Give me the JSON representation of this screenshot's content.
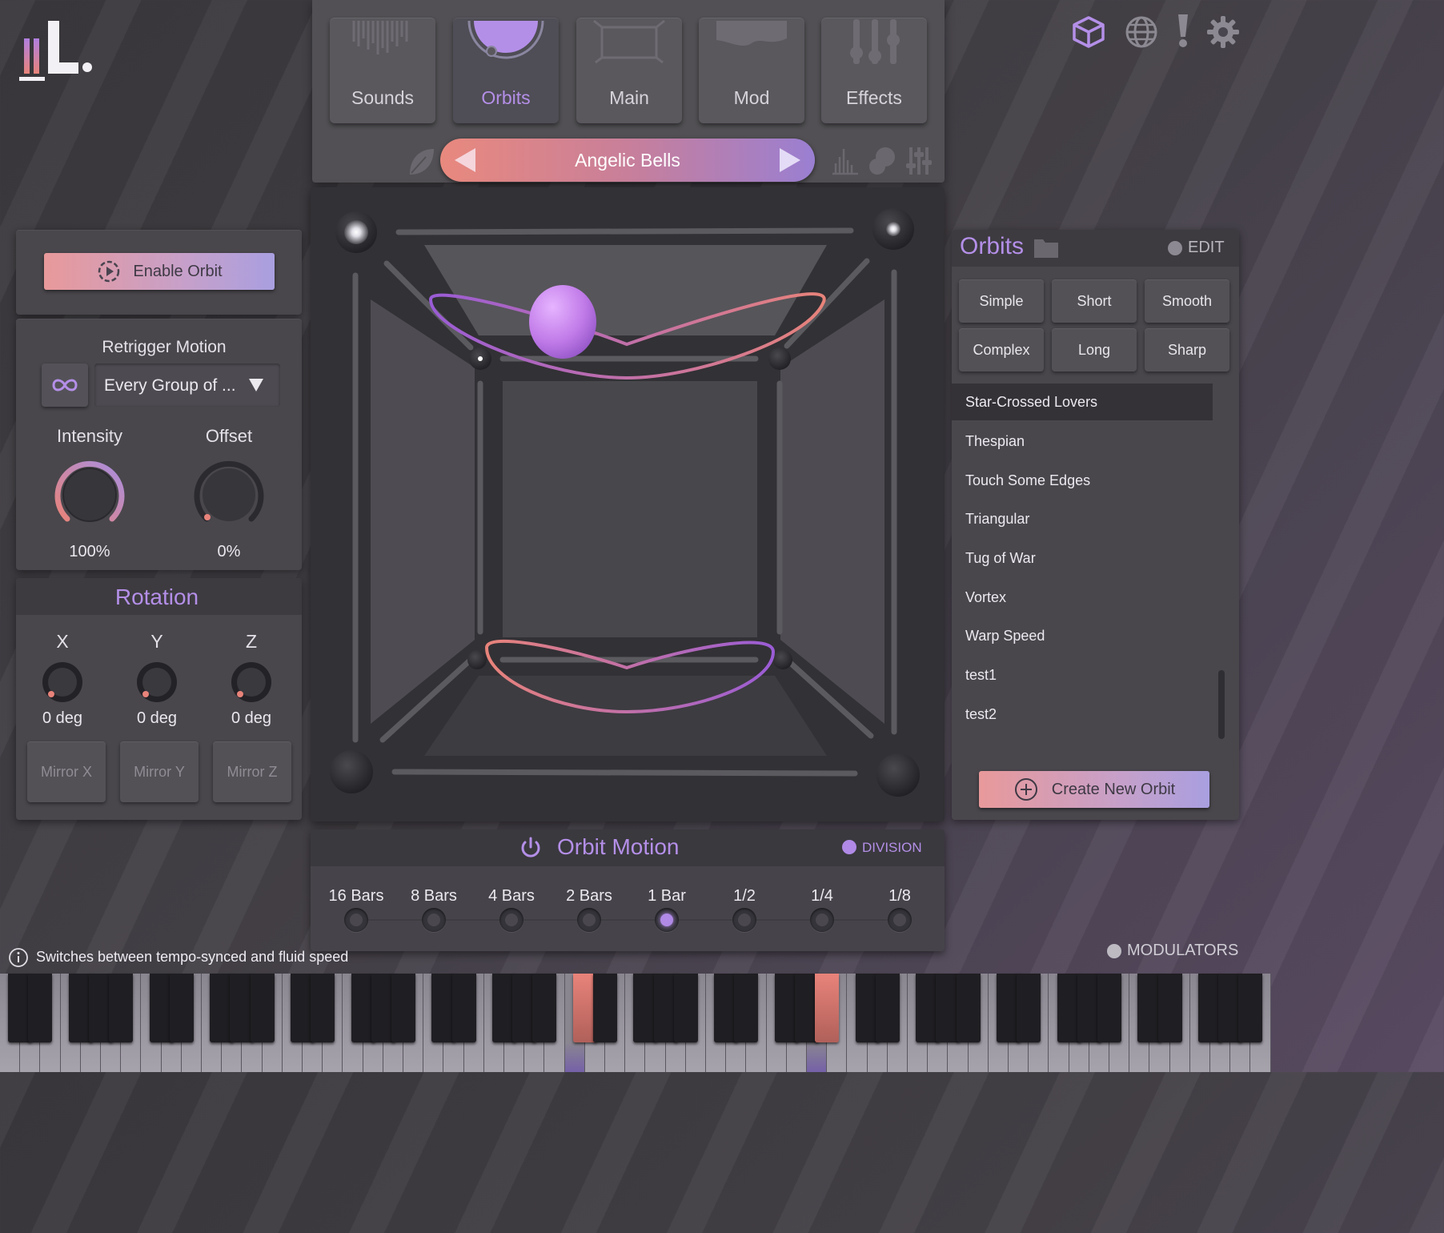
{
  "app": {
    "name": "L."
  },
  "header_icons": [
    "cube-icon",
    "globe-icon",
    "alert-icon",
    "gear-icon"
  ],
  "tabs": [
    {
      "label": "Sounds"
    },
    {
      "label": "Orbits",
      "active": true
    },
    {
      "label": "Main"
    },
    {
      "label": "Mod"
    },
    {
      "label": "Effects"
    }
  ],
  "preset": {
    "name": "Angelic Bells"
  },
  "enable_orbit": {
    "label": "Enable Orbit"
  },
  "retrigger": {
    "title": "Retrigger Motion",
    "select_value": "Every Group of ...",
    "intensity": {
      "label": "Intensity",
      "value": "100%",
      "fraction": 1.0
    },
    "offset": {
      "label": "Offset",
      "value": "0%",
      "fraction": 0.0
    }
  },
  "rotation": {
    "title": "Rotation",
    "axes": [
      {
        "label": "X",
        "value": "0 deg"
      },
      {
        "label": "Y",
        "value": "0 deg"
      },
      {
        "label": "Z",
        "value": "0 deg"
      }
    ],
    "mirror": [
      "Mirror X",
      "Mirror Y",
      "Mirror Z"
    ]
  },
  "orbit_motion": {
    "title": "Orbit Motion",
    "mode_label": "DIVISION",
    "divisions": [
      "16 Bars",
      "8 Bars",
      "4 Bars",
      "2 Bars",
      "1 Bar",
      "1/2",
      "1/4",
      "1/8"
    ],
    "selected": "1 Bar"
  },
  "orbits_panel": {
    "title": "Orbits",
    "edit_label": "EDIT",
    "presets": [
      "Simple",
      "Short",
      "Smooth",
      "Complex",
      "Long",
      "Sharp"
    ],
    "list": [
      "Star-Crossed Lovers",
      "Thespian",
      "Touch Some Edges",
      "Triangular",
      "Tug of War",
      "Vortex",
      "Warp Speed",
      "test1",
      "test2"
    ],
    "selected": "Star-Crossed Lovers",
    "create_label": "Create New Orbit"
  },
  "status": {
    "hint": "Switches between tempo-synced and fluid speed"
  },
  "modulators": {
    "label": "MODULATORS"
  },
  "colors": {
    "accent": "#b48fe8",
    "gradient_start": "#e8999a",
    "gradient_end": "#a99fe0"
  }
}
